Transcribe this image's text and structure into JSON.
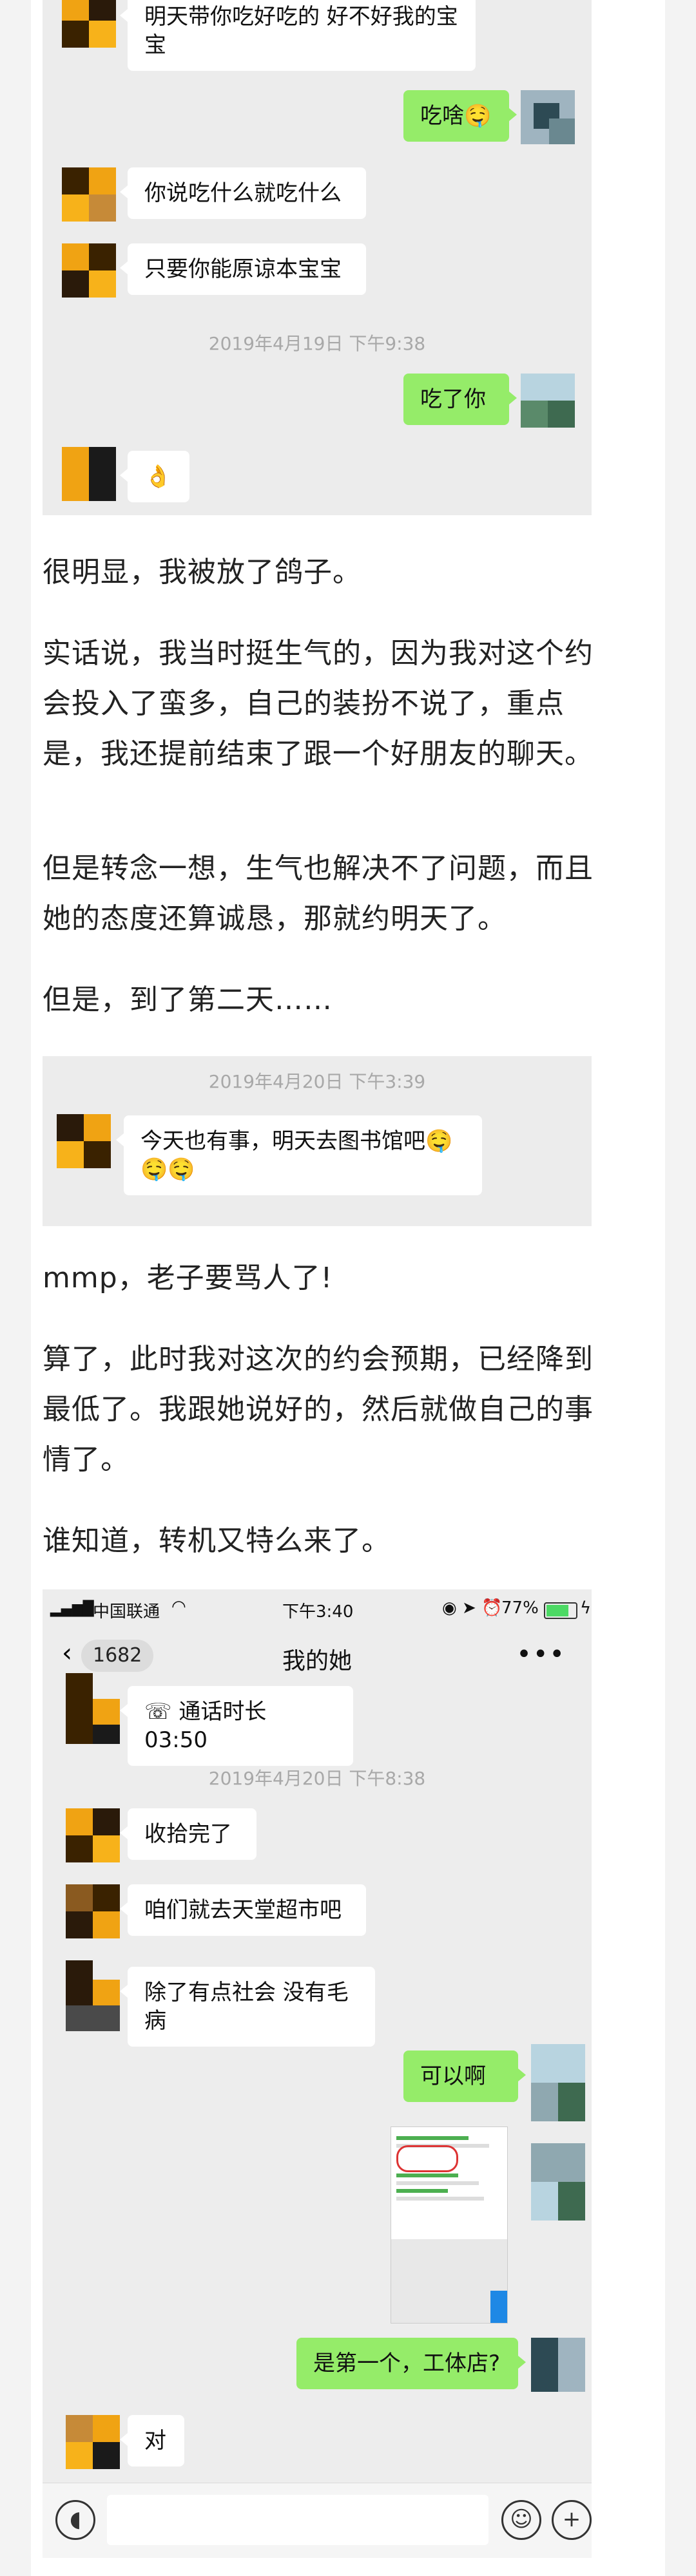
{
  "chat1": {
    "msg1": "明天带你吃好吃的 好不好我的宝宝",
    "msg2": "吃啥🤤",
    "msg3": "你说吃什么就吃什么",
    "msg4": "只要你能原谅本宝宝",
    "timestamp": "2019年4月19日 下午9:38",
    "msg5": "吃了你",
    "msg6": "👌"
  },
  "paragraphs": {
    "p1": "很明显，我被放了鸽子。",
    "p2": "实话说，我当时挺生气的，因为我对这个约会投入了蛮多，自己的装扮不说了，重点是，我还提前结束了跟一个好朋友的聊天。",
    "p3": "但是转念一想，生气也解决不了问题，而且她的态度还算诚恳，那就约明天了。",
    "p4": "但是，到了第二天……",
    "p5": "mmp，老子要骂人了!",
    "p6": "算了，此时我对这次的约会预期，已经降到最低了。我跟她说好的，然后就做自己的事情了。",
    "p7": "谁知道，转机又特么来了。"
  },
  "chat2": {
    "timestamp": "2019年4月20日 下午3:39",
    "msg1": "今天也有事，明天去图书馆吧🤤🤤🤤"
  },
  "phone": {
    "carrier": "中国联通",
    "time": "下午3:40",
    "battery": "77%",
    "back_count": "1682",
    "title": "我的她",
    "call_text": "通话时长 03:50",
    "timestamp": "2019年4月20日 下午8:38",
    "msg1": "收拾完了",
    "msg2": "咱们就去天堂超市吧",
    "msg3": "除了有点社会 没有毛病",
    "msg4": "可以啊",
    "msg5": "是第一个，工体店?",
    "msg6": "对"
  }
}
